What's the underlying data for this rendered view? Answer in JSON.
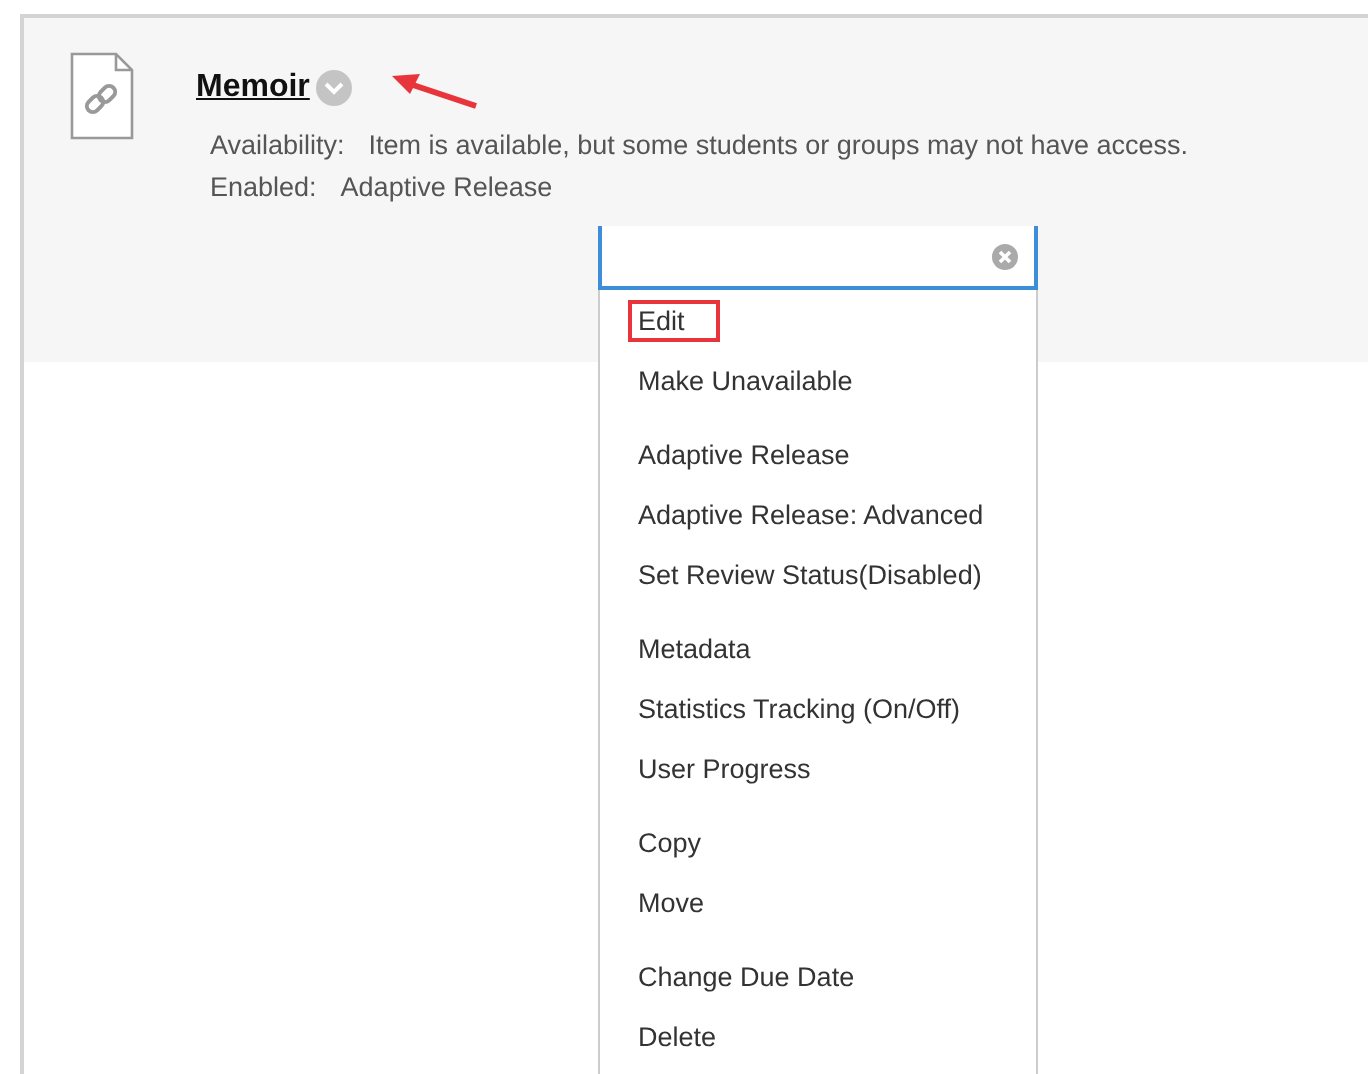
{
  "item": {
    "title": "Memoir",
    "details": [
      {
        "label": "Availability:",
        "value": "Item is available, but some students or groups may not have access."
      },
      {
        "label": "Enabled:",
        "value": "Adaptive Release"
      }
    ]
  },
  "menu": {
    "groups": [
      [
        {
          "label": "Edit",
          "highlighted": true
        },
        {
          "label": "Make Unavailable",
          "highlighted": false
        }
      ],
      [
        {
          "label": "Adaptive Release",
          "highlighted": false
        },
        {
          "label": "Adaptive Release: Advanced",
          "highlighted": false
        },
        {
          "label": "Set Review Status(Disabled)",
          "highlighted": false
        }
      ],
      [
        {
          "label": "Metadata",
          "highlighted": false
        },
        {
          "label": "Statistics Tracking (On/Off)",
          "highlighted": false
        },
        {
          "label": "User Progress",
          "highlighted": false
        }
      ],
      [
        {
          "label": "Copy",
          "highlighted": false
        },
        {
          "label": "Move",
          "highlighted": false
        }
      ],
      [
        {
          "label": "Change Due Date",
          "highlighted": false
        },
        {
          "label": "Delete",
          "highlighted": false
        }
      ]
    ]
  }
}
